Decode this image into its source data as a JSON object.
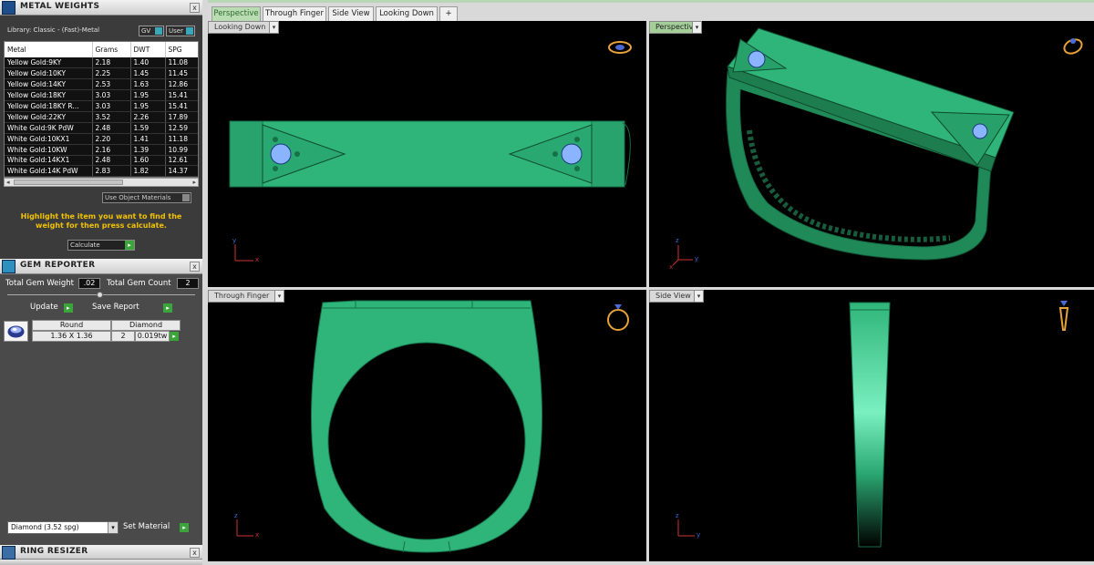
{
  "metal_panel": {
    "title": "METAL WEIGHTS",
    "close": "x",
    "library": "Library: Classic - (Fast)-Metal",
    "gv_label": "GV",
    "user_label": "User",
    "columns": [
      "Metal",
      "Grams",
      "DWT",
      "SPG"
    ],
    "rows": [
      [
        "Yellow Gold:9KY",
        "2.18",
        "1.40",
        "11.08"
      ],
      [
        "Yellow Gold:10KY",
        "2.25",
        "1.45",
        "11.45"
      ],
      [
        "Yellow Gold:14KY",
        "2.53",
        "1.63",
        "12.86"
      ],
      [
        "Yellow Gold:18KY",
        "3.03",
        "1.95",
        "15.41"
      ],
      [
        "Yellow Gold:18KY R...",
        "3.03",
        "1.95",
        "15.41"
      ],
      [
        "Yellow Gold:22KY",
        "3.52",
        "2.26",
        "17.89"
      ],
      [
        "White Gold:9K PdW",
        "2.48",
        "1.59",
        "12.59"
      ],
      [
        "White Gold:10KX1",
        "2.20",
        "1.41",
        "11.18"
      ],
      [
        "White Gold:10KW",
        "2.16",
        "1.39",
        "10.99"
      ],
      [
        "White Gold:14KX1",
        "2.48",
        "1.60",
        "12.61"
      ],
      [
        "White Gold:14K PdW",
        "2.83",
        "1.82",
        "14.37"
      ]
    ],
    "use_object_materials": "Use Object Materials",
    "hint": "Highlight the item you want to find the weight for then press calculate.",
    "calculate": "Calculate"
  },
  "gem_panel": {
    "title": "GEM REPORTER",
    "close": "x",
    "total_weight_label": "Total Gem Weight",
    "total_weight_value": ".02",
    "total_count_label": "Total Gem Count",
    "total_count_value": "2",
    "update": "Update",
    "save_report": "Save Report",
    "gem": {
      "shape": "Round",
      "type": "Diamond",
      "size": "1.36 X 1.36",
      "count": "2",
      "weight": "0.019tw"
    },
    "material_select": "Diamond     (3.52 spg)",
    "set_material": "Set Material"
  },
  "resizer_panel": {
    "title": "RING RESIZER",
    "close": "x"
  },
  "tabs": [
    "Perspective",
    "Through Finger",
    "Side View",
    "Looking Down",
    "+"
  ],
  "viewports": {
    "top_left": "Looking Down",
    "top_right": "Perspective",
    "bottom_left": "Through Finger",
    "bottom_right": "Side View"
  },
  "axes": {
    "looking_down": [
      "y",
      "x"
    ],
    "perspective": [
      "z",
      "y",
      "x"
    ],
    "through_finger": [
      "z",
      "x"
    ],
    "side_view": [
      "z",
      "y"
    ]
  },
  "colors": {
    "ring_green": "#2fb57a",
    "ring_dark": "#1d7d4f",
    "gem_blue": "#8ab4ff",
    "tab_active": "#b9dcb2",
    "hint_yellow": "#f2c200"
  }
}
